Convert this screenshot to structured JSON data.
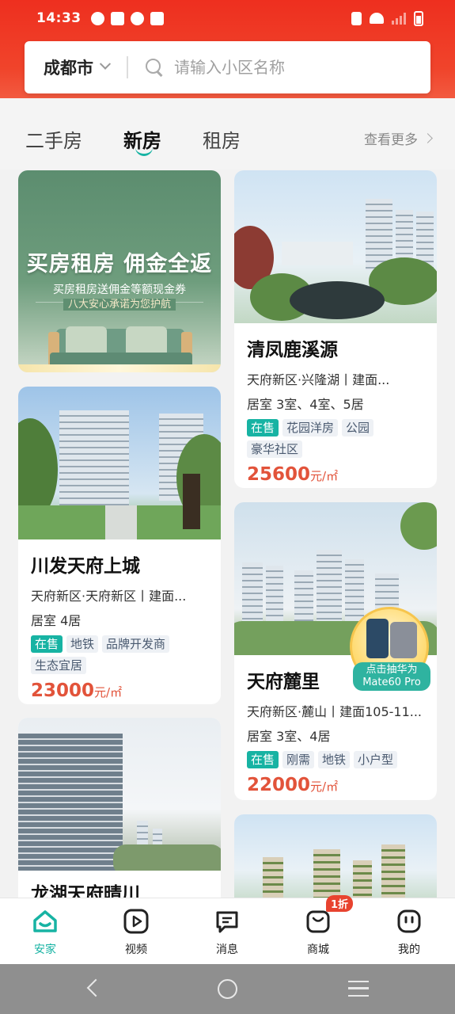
{
  "status_bar": {
    "time": "14:33"
  },
  "search": {
    "city": "成都市",
    "placeholder": "请输入小区名称"
  },
  "tabs": [
    {
      "label": "二手房"
    },
    {
      "label": "新房"
    },
    {
      "label": "租房"
    }
  ],
  "more": "查看更多",
  "promo": {
    "title": "买房租房 佣金全返",
    "subtitle": "买房租房送佣金等额现金券",
    "tagline": "八大安心承诺为您护航"
  },
  "listings": [
    {
      "name": "清凤鹿溪源",
      "address": "天府新区·兴隆湖丨建面...",
      "rooms": "居室  3室、4室、5居",
      "tags": [
        "在售",
        "花园洋房",
        "公园",
        "豪华社区"
      ],
      "price": "25600",
      "unit": "元/㎡"
    },
    {
      "name": "川发天府上城",
      "address": "天府新区·天府新区丨建面...",
      "rooms": "居室  4居",
      "tags": [
        "在售",
        "地铁",
        "品牌开发商",
        "生态宜居"
      ],
      "price": "23000",
      "unit": "元/㎡"
    },
    {
      "name": "天府麓里",
      "address": "天府新区·麓山丨建面105-11...",
      "rooms": "居室  3室、4居",
      "tags": [
        "在售",
        "刚需",
        "地铁",
        "小户型"
      ],
      "price": "22000",
      "unit": "元/㎡",
      "badge_line1": "点击抽华为",
      "badge_line2": "Mate60 Pro"
    },
    {
      "name": "龙湖天府晴川"
    }
  ],
  "bottom_nav": [
    {
      "label": "安家"
    },
    {
      "label": "视频"
    },
    {
      "label": "消息"
    },
    {
      "label": "商城",
      "badge": "1折"
    },
    {
      "label": "我的"
    }
  ],
  "colors": {
    "brand_red": "#ee2f1f",
    "accent_teal": "#17b3a3",
    "price_red": "#e2533a"
  }
}
